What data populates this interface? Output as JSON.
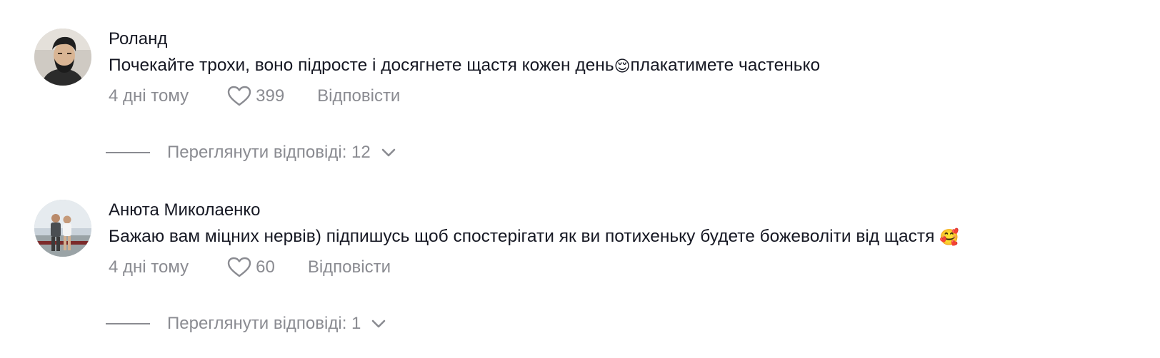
{
  "comments": [
    {
      "author": "Роланд",
      "text_before": "Почекайте трохи, воно підросте і досягнете щастя кожен день",
      "emoji": "😌",
      "text_after": "плакатимете частенько",
      "date": "4 дні тому",
      "likes": "399",
      "reply_label": "Відповісти",
      "view_replies": "Переглянути відповіді: 12"
    },
    {
      "author": "Анюта Миколаенко",
      "text_before": "Бажаю вам міцних нервів) підпишусь щоб спостерігати як ви потихеньку будете божеволіти від щастя ",
      "emoji": "🥰",
      "text_after": "",
      "date": "4 дні тому",
      "likes": "60",
      "reply_label": "Відповісти",
      "view_replies": "Переглянути відповіді: 1"
    }
  ],
  "icons": {
    "like": "heart-outline-icon",
    "expand": "chevron-down-icon"
  },
  "colors": {
    "primary_text": "#161823",
    "secondary_text": "#8a8b91"
  }
}
